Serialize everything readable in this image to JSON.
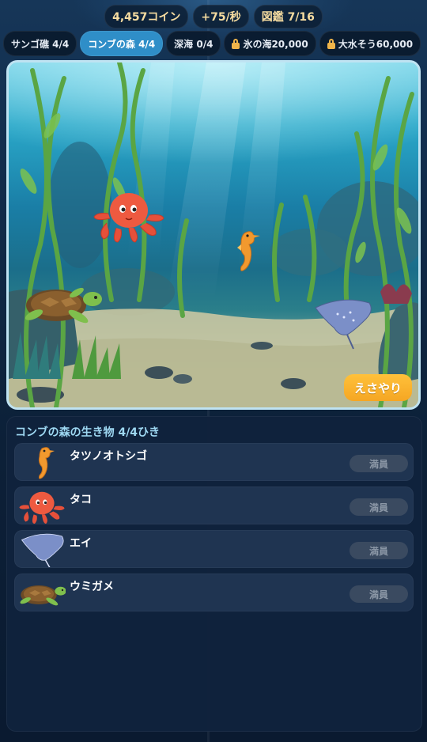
{
  "stats": {
    "coins": "4,457コイン",
    "rate": "+75/秒",
    "collection": "図鑑 7/16"
  },
  "tabs": [
    {
      "label": "サンゴ礁 4/4",
      "locked": false,
      "active": false
    },
    {
      "label": "コンブの森 4/4",
      "locked": false,
      "active": true
    },
    {
      "label": "深海 0/4",
      "locked": false,
      "active": false
    },
    {
      "label": "氷の海20,000",
      "locked": true,
      "active": false
    },
    {
      "label": "大水そう60,000",
      "locked": true,
      "active": false
    }
  ],
  "tank": {
    "feed_button": "えさやり",
    "creatures": [
      "octopus-icon",
      "seahorse-icon",
      "turtle-icon",
      "ray-icon"
    ]
  },
  "panel": {
    "title": "コンブの森の生き物 4/4ひき",
    "creatures": [
      {
        "name": "タツノオトシゴ",
        "icon": "seahorse-icon",
        "status": "満員"
      },
      {
        "name": "タコ",
        "icon": "octopus-icon",
        "status": "満員"
      },
      {
        "name": "エイ",
        "icon": "ray-icon",
        "status": "満員"
      },
      {
        "name": "ウミガメ",
        "icon": "turtle-icon",
        "status": "満員"
      }
    ]
  },
  "colors": {
    "accent_tab": "#2f8ec8",
    "coin_text": "#f6dca0",
    "feed_button": "#f5a623",
    "panel_title": "#9ed8f2",
    "lock": "#f0b54a"
  }
}
